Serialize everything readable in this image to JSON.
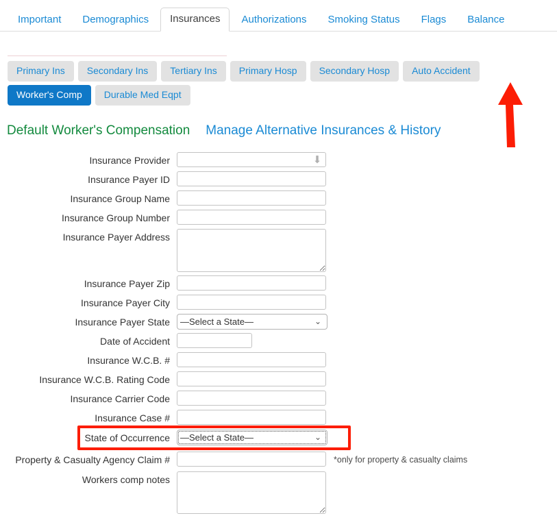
{
  "tabs": [
    {
      "label": "Important",
      "active": false
    },
    {
      "label": "Demographics",
      "active": false
    },
    {
      "label": "Insurances",
      "active": true
    },
    {
      "label": "Authorizations",
      "active": false
    },
    {
      "label": "Smoking Status",
      "active": false
    },
    {
      "label": "Flags",
      "active": false
    },
    {
      "label": "Balance",
      "active": false
    }
  ],
  "subtabs": [
    {
      "label": "Primary Ins",
      "active": false
    },
    {
      "label": "Secondary Ins",
      "active": false
    },
    {
      "label": "Tertiary Ins",
      "active": false
    },
    {
      "label": "Primary Hosp",
      "active": false
    },
    {
      "label": "Secondary Hosp",
      "active": false
    },
    {
      "label": "Auto Accident",
      "active": false
    },
    {
      "label": "Worker's Comp",
      "active": true
    },
    {
      "label": "Durable Med Eqpt",
      "active": false
    }
  ],
  "headings": {
    "default_title": "Default Worker's Compensation",
    "manage_link": "Manage Alternative Insurances & History"
  },
  "form": {
    "insurance_provider": {
      "label": "Insurance Provider",
      "value": "",
      "placeholder": ""
    },
    "insurance_payer_id": {
      "label": "Insurance Payer ID",
      "value": "",
      "placeholder": ""
    },
    "insurance_group_name": {
      "label": "Insurance Group Name",
      "value": "",
      "placeholder": ""
    },
    "insurance_group_number": {
      "label": "Insurance Group Number",
      "value": "",
      "placeholder": ""
    },
    "insurance_payer_address": {
      "label": "Insurance Payer Address",
      "value": "",
      "placeholder": ""
    },
    "insurance_payer_zip": {
      "label": "Insurance Payer Zip",
      "value": "",
      "placeholder": ""
    },
    "insurance_payer_city": {
      "label": "Insurance Payer City",
      "value": "",
      "placeholder": ""
    },
    "insurance_payer_state": {
      "label": "Insurance Payer State",
      "value": "—Select a State—"
    },
    "date_of_accident": {
      "label": "Date of Accident",
      "value": "",
      "placeholder": ""
    },
    "insurance_wcb_number": {
      "label": "Insurance W.C.B. #",
      "value": "",
      "placeholder": ""
    },
    "insurance_wcb_rating_code": {
      "label": "Insurance W.C.B. Rating Code",
      "value": "",
      "placeholder": ""
    },
    "insurance_carrier_code": {
      "label": "Insurance Carrier Code",
      "value": "",
      "placeholder": ""
    },
    "insurance_case_number": {
      "label": "Insurance Case #",
      "value": "",
      "placeholder": ""
    },
    "state_of_occurrence": {
      "label": "State of Occurrence",
      "value": "—Select a State—"
    },
    "property_casualty_claim": {
      "label": "Property & Casualty Agency Claim #",
      "value": "",
      "placeholder": "",
      "hint": "*only for property & casualty claims"
    },
    "workers_comp_notes": {
      "label": "Workers comp notes",
      "value": "",
      "placeholder": ""
    }
  },
  "icons": {
    "provider_dropdown": "⬇",
    "select_chevron": "⌄"
  },
  "annotations": {
    "highlight_color": "#fc1d05",
    "arrow_color": "#fc1d05",
    "arrow_target": "Worker's Comp",
    "highlight_target": "State of Occurrence"
  },
  "colors": {
    "accent_blue": "#1a8ad4",
    "active_tab_blue": "#0f78c7",
    "green_heading": "#138a3e",
    "subtab_gray": "#e2e2e2"
  }
}
